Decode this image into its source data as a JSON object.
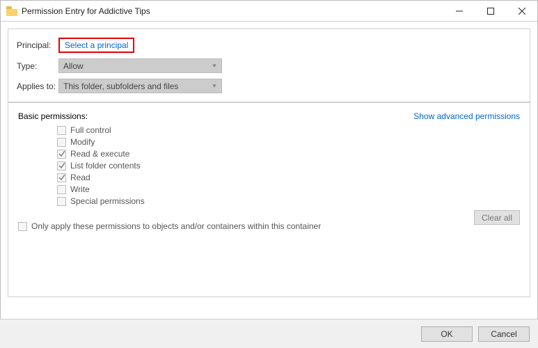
{
  "window": {
    "title": "Permission Entry for Addictive Tips"
  },
  "form": {
    "principal_label": "Principal:",
    "principal_link": "Select a principal",
    "type_label": "Type:",
    "type_value": "Allow",
    "applies_label": "Applies to:",
    "applies_value": "This folder, subfolders and files"
  },
  "permissions": {
    "heading": "Basic permissions:",
    "advanced_link": "Show advanced permissions",
    "items": [
      {
        "label": "Full control",
        "checked": false
      },
      {
        "label": "Modify",
        "checked": false
      },
      {
        "label": "Read & execute",
        "checked": true
      },
      {
        "label": "List folder contents",
        "checked": true
      },
      {
        "label": "Read",
        "checked": true
      },
      {
        "label": "Write",
        "checked": false
      },
      {
        "label": "Special permissions",
        "checked": false
      }
    ],
    "only_apply": "Only apply these permissions to objects and/or containers within this container",
    "clear_all": "Clear all"
  },
  "footer": {
    "ok": "OK",
    "cancel": "Cancel"
  }
}
